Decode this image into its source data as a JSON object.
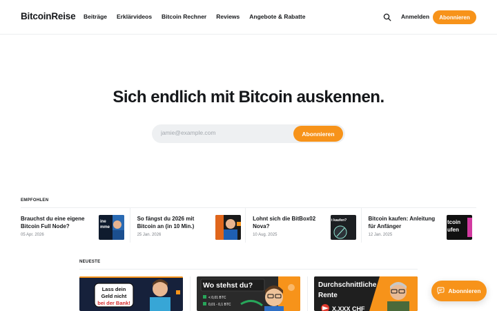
{
  "header": {
    "logo": "BitcoinReise",
    "nav": [
      "Beiträge",
      "Erklärvideos",
      "Bitcoin Rechner",
      "Reviews",
      "Angebote & Rabatte"
    ],
    "search_icon": "search-icon",
    "login_label": "Anmelden",
    "subscribe_label": "Abonnieren"
  },
  "hero": {
    "title": "Sich endlich mit Bitcoin auskennen.",
    "email_placeholder": "jamie@example.com",
    "button_label": "Abonnieren"
  },
  "featured": {
    "label": "EMPFOHLEN",
    "items": [
      {
        "title": "Brauchst du eine eigene Bitcoin Full Node?",
        "date": "05 Apr. 2026",
        "thumb_text": "ine\nmme"
      },
      {
        "title": "So fängst du 2026 mit Bitcoin an (in 10 Min.)",
        "date": "25 Jan. 2026",
        "thumb_text": ""
      },
      {
        "title": "Lohnt sich die BitBox02 Nova?",
        "date": "10 Aug. 2025",
        "thumb_text": "t kaufen?"
      },
      {
        "title": "Bitcoin kaufen: Anleitung für Anfänger",
        "date": "12 Jan. 2025",
        "thumb_text": "tcoin\nufen"
      }
    ]
  },
  "newest": {
    "label": "NEUESTE",
    "cards": [
      {
        "headline_1": "Lass dein",
        "headline_2": "Geld nicht",
        "headline_3": "bei der Bank!"
      },
      {
        "headline": "Wo stehst du?",
        "row_1": "< 0,01 BTC",
        "row_2": "0,01 - 0,1 BTC"
      },
      {
        "headline_1": "Durchschnittliche",
        "headline_2": "Rente",
        "footer": "X.XXX CHF"
      }
    ]
  },
  "portal": {
    "label": "Abonnieren",
    "icon": "chat-icon"
  },
  "colors": {
    "accent": "#f7931a",
    "text": "#15171a",
    "muted": "#7c8087",
    "input_bg": "#eef0f2"
  }
}
